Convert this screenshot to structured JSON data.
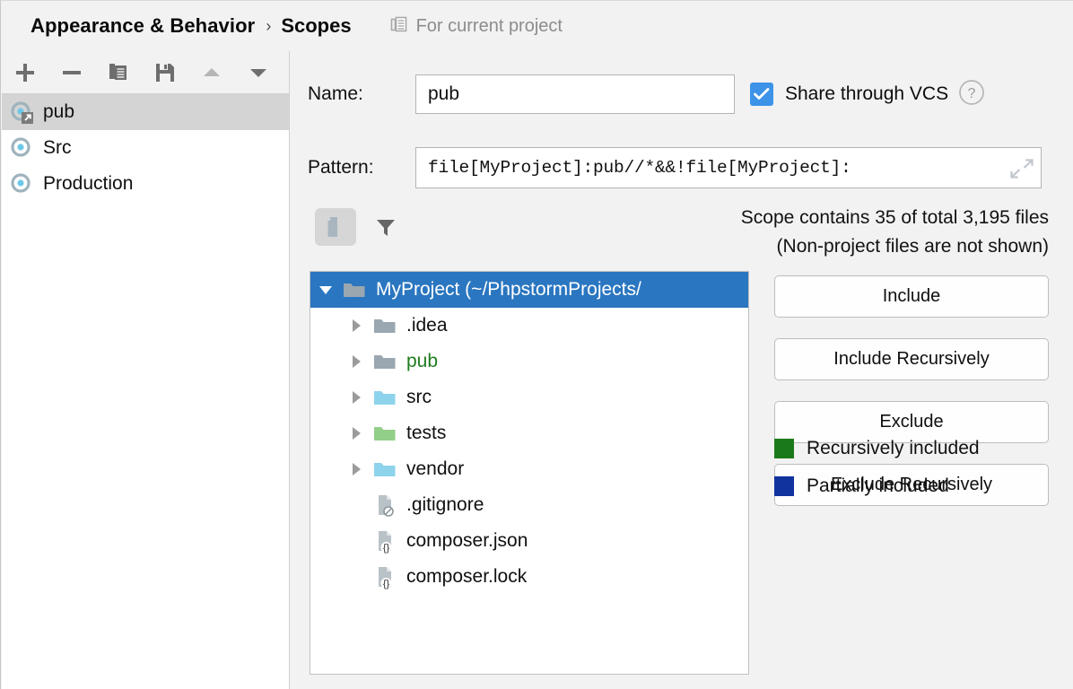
{
  "header": {
    "breadcrumb_parent": "Appearance & Behavior",
    "breadcrumb_sep": "›",
    "breadcrumb_current": "Scopes",
    "scope_target_label": "For current project",
    "scope_target_icon": "copy-icon"
  },
  "left_toolbar": {
    "buttons": [
      {
        "name": "add-scope-button",
        "icon": "plus-icon",
        "tooltip": "Add"
      },
      {
        "name": "remove-scope-button",
        "icon": "minus-icon",
        "tooltip": "Remove"
      },
      {
        "name": "duplicate-scope-button",
        "icon": "copy-icon",
        "tooltip": "Duplicate"
      },
      {
        "name": "save-scope-button",
        "icon": "save-icon",
        "tooltip": "Save"
      },
      {
        "name": "move-up-button",
        "icon": "triangle-up-icon",
        "tooltip": "Move Up"
      },
      {
        "name": "move-down-button",
        "icon": "triangle-down-icon",
        "tooltip": "Move Down"
      }
    ]
  },
  "scope_list": {
    "items": [
      {
        "label": "pub",
        "selected": true,
        "shared": true
      },
      {
        "label": "Src",
        "selected": false,
        "shared": false
      },
      {
        "label": "Production",
        "selected": false,
        "shared": false
      }
    ]
  },
  "form": {
    "name_label": "Name:",
    "name_value": "pub",
    "name_placeholder": "",
    "pattern_label": "Pattern:",
    "pattern_value": "file[MyProject]:pub//*&&!file[MyProject]:",
    "pattern_placeholder": "",
    "expand_icon": "expand-icon",
    "share_vcs_label": "Share through VCS",
    "share_vcs_checked": true,
    "help_icon": "question-mark-icon"
  },
  "tree_toolbar": {
    "show_files_icon": "file-icon",
    "show_files_pressed": true,
    "filter_icon": "funnel-icon"
  },
  "scope_info": {
    "line1": "Scope contains 35 of total 3,195 files",
    "line2": "(Non-project files are not shown)"
  },
  "tree": {
    "rows": [
      {
        "label": "MyProject (~/PhpstormProjects/",
        "depth": 0,
        "kind": "folder",
        "folder_color": "#9aa7b0",
        "expanded": true,
        "selected": true,
        "text_color": "white"
      },
      {
        "label": ".idea",
        "depth": 1,
        "kind": "folder",
        "folder_color": "#9aa7b0",
        "expanded": false,
        "selected": false,
        "text_color": "black"
      },
      {
        "label": "pub",
        "depth": 1,
        "kind": "folder",
        "folder_color": "#9aa7b0",
        "expanded": false,
        "selected": false,
        "text_color": "green"
      },
      {
        "label": "src",
        "depth": 1,
        "kind": "folder",
        "folder_color": "#8ed3ec",
        "expanded": false,
        "selected": false,
        "text_color": "black"
      },
      {
        "label": "tests",
        "depth": 1,
        "kind": "folder",
        "folder_color": "#93cf88",
        "expanded": false,
        "selected": false,
        "text_color": "black"
      },
      {
        "label": "vendor",
        "depth": 1,
        "kind": "folder",
        "folder_color": "#8ed3ec",
        "expanded": false,
        "selected": false,
        "text_color": "black"
      },
      {
        "label": ".gitignore",
        "depth": 1,
        "kind": "file",
        "badge": "ignore",
        "expanded": false,
        "selected": false,
        "text_color": "black"
      },
      {
        "label": "composer.json",
        "depth": 1,
        "kind": "file",
        "badge": "json",
        "expanded": false,
        "selected": false,
        "text_color": "black"
      },
      {
        "label": "composer.lock",
        "depth": 1,
        "kind": "file",
        "badge": "json",
        "expanded": false,
        "selected": false,
        "text_color": "black"
      }
    ]
  },
  "actions": {
    "buttons": [
      {
        "label": "Include",
        "name": "include-button"
      },
      {
        "label": "Include Recursively",
        "name": "include-recursively-button"
      },
      {
        "label": "Exclude",
        "name": "exclude-button"
      },
      {
        "label": "Exclude Recursively",
        "name": "exclude-recursively-button"
      }
    ]
  },
  "legend": {
    "items": [
      {
        "label": "Recursively included",
        "color": "#1a7a1a"
      },
      {
        "label": "Partially included",
        "color": "#11339e"
      }
    ]
  },
  "colors": {
    "selection_blue": "#2a76c0",
    "list_selection_gray": "#d4d4d4",
    "panel_bg": "#f2f2f2",
    "checkbox_blue": "#3c93e8",
    "green_text": "#1e7c1e"
  }
}
